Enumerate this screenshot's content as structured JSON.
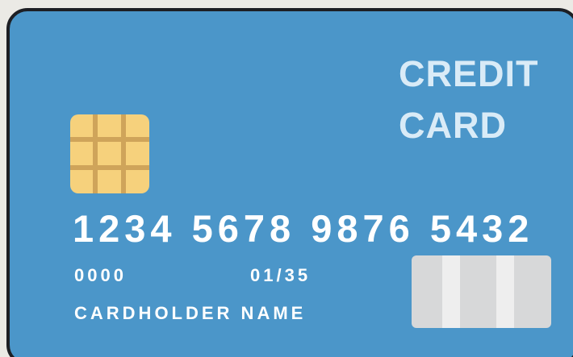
{
  "card": {
    "title_line_1": "CREDIT",
    "title_line_2": "CARD",
    "number": "1234 5678 9876 5432",
    "security_code": "0000",
    "expiry": "01/35",
    "cardholder": "CARDHOLDER NAME"
  },
  "colors": {
    "background": "#ebeae5",
    "card": "#4b96c9",
    "border": "#1d1f24",
    "chip": "#f6d17c",
    "chip_lines": "#cfa45a",
    "signature_panel": "#d7d8d9"
  },
  "icons": {
    "chip": "chip-icon",
    "signature_panel": "signature-panel-icon"
  }
}
